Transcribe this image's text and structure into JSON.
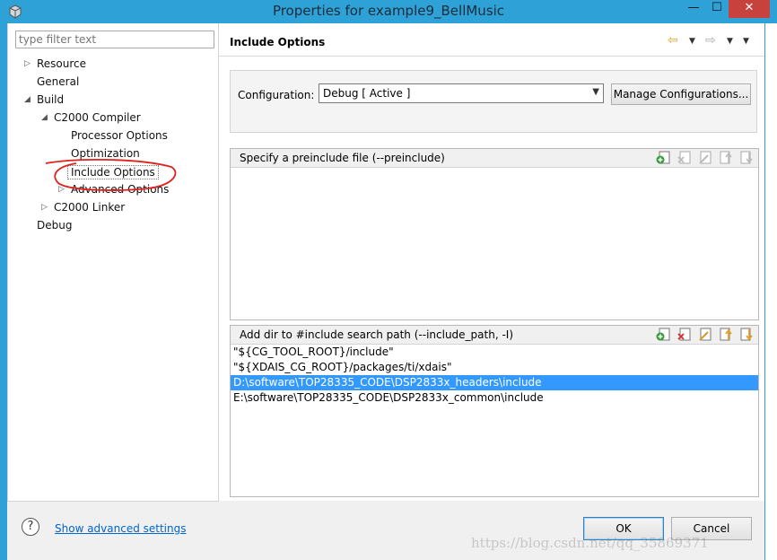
{
  "window": {
    "title": "Properties for example9_BellMusic",
    "minimize_glyph": "—",
    "maximize_glyph": "☐",
    "close_glyph": "✕",
    "app_icon": "cube-icon"
  },
  "sidebar": {
    "filter_placeholder": "type filter text",
    "items": [
      {
        "label": "Resource",
        "level": 1,
        "twisty": "collapsed"
      },
      {
        "label": "General",
        "level": 1,
        "twisty": "none"
      },
      {
        "label": "Build",
        "level": 1,
        "twisty": "expanded"
      },
      {
        "label": "C2000 Compiler",
        "level": 2,
        "twisty": "expanded"
      },
      {
        "label": "Processor Options",
        "level": 3,
        "twisty": "none"
      },
      {
        "label": "Optimization",
        "level": 3,
        "twisty": "none"
      },
      {
        "label": "Include Options",
        "level": 3,
        "twisty": "none",
        "selected": true
      },
      {
        "label": "Advanced Options",
        "level": 3,
        "twisty": "collapsed"
      },
      {
        "label": "C2000 Linker",
        "level": 2,
        "twisty": "collapsed"
      },
      {
        "label": "Debug",
        "level": 1,
        "twisty": "none"
      }
    ],
    "annotation_color": "#e0201a"
  },
  "page": {
    "title": "Include Options",
    "nav_back_icon": "arrow-left-icon",
    "nav_forward_icon": "arrow-right-icon"
  },
  "configuration": {
    "label": "Configuration:",
    "value": "Debug  [ Active ]",
    "manage_label": "Manage Configurations..."
  },
  "preinclude": {
    "title": "Specify a preinclude file (--preinclude)",
    "items": []
  },
  "include_path": {
    "title": "Add dir to #include search path (--include_path, -I)",
    "items": [
      "\"${CG_TOOL_ROOT}/include\"",
      "\"${XDAIS_CG_ROOT}/packages/ti/xdais\"",
      "D:\\software\\TOP28335_CODE\\DSP2833x_headers\\include",
      "E:\\software\\TOP28335_CODE\\DSP2833x_common\\include"
    ],
    "selected_index": 2
  },
  "footer": {
    "help_glyph": "?",
    "advanced_link": "Show advanced settings",
    "ok_label": "OK",
    "cancel_label": "Cancel"
  },
  "watermark": "https://blog.csdn.net/qq_35869371",
  "colors": {
    "titlebar": "#2ea1d7",
    "selection": "#3399ff",
    "link": "#0066cc",
    "close": "#c7413d"
  }
}
